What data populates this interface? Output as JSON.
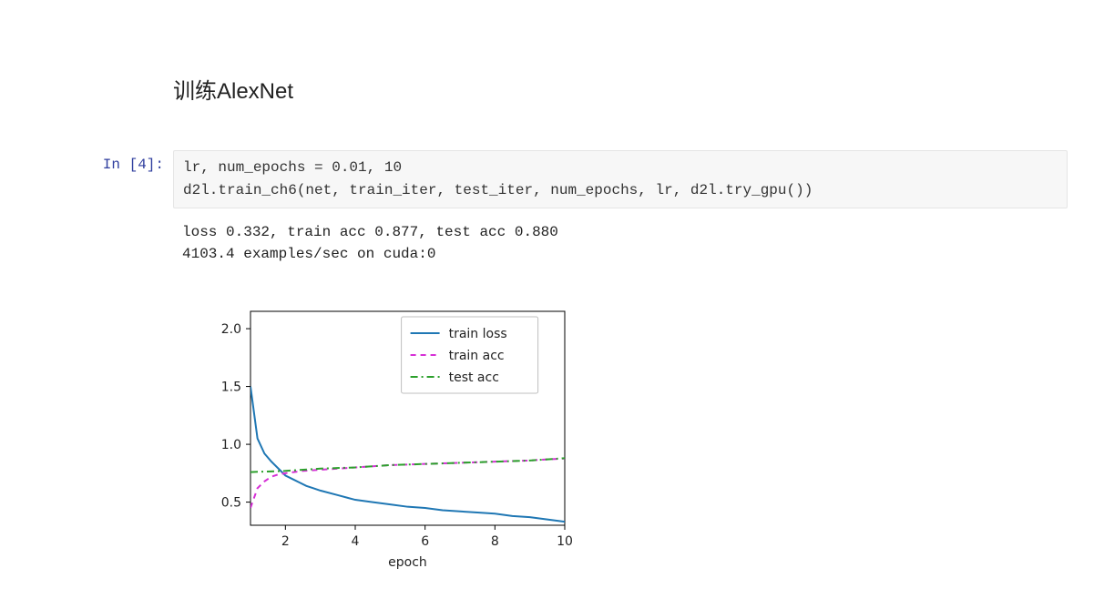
{
  "title": "训练AlexNet",
  "prompt": "In [4]:",
  "code": "lr, num_epochs = 0.01, 10\nd2l.train_ch6(net, train_iter, test_iter, num_epochs, lr, d2l.try_gpu())",
  "output": "loss 0.332, train acc 0.877, test acc 0.880\n4103.4 examples/sec on cuda:0",
  "chart_data": {
    "type": "line",
    "xlabel": "epoch",
    "ylabel": "",
    "xlim": [
      1,
      10
    ],
    "ylim": [
      0.3,
      2.15
    ],
    "x_ticks": [
      2,
      4,
      6,
      8,
      10
    ],
    "y_ticks": [
      0.5,
      1.0,
      1.5,
      2.0
    ],
    "legend": [
      "train loss",
      "train acc",
      "test acc"
    ],
    "series": [
      {
        "name": "train loss",
        "color": "#1f77b4",
        "dash": "solid",
        "x": [
          1.0,
          1.2,
          1.4,
          1.6,
          1.8,
          2.0,
          2.2,
          2.4,
          2.6,
          2.8,
          3.0,
          3.5,
          4.0,
          4.5,
          5.0,
          5.5,
          6.0,
          6.5,
          7.0,
          7.5,
          8.0,
          8.5,
          9.0,
          9.5,
          10.0
        ],
        "values": [
          1.5,
          1.05,
          0.92,
          0.85,
          0.79,
          0.73,
          0.7,
          0.67,
          0.64,
          0.62,
          0.6,
          0.56,
          0.52,
          0.5,
          0.48,
          0.46,
          0.45,
          0.43,
          0.42,
          0.41,
          0.4,
          0.38,
          0.37,
          0.35,
          0.33
        ]
      },
      {
        "name": "train acc",
        "color": "#d62fd6",
        "dash": "dashed",
        "x": [
          1.0,
          1.2,
          1.4,
          1.6,
          1.8,
          2.0,
          2.5,
          3.0,
          3.5,
          4.0,
          4.5,
          5.0,
          5.5,
          6.0,
          6.5,
          7.0,
          7.5,
          8.0,
          8.5,
          9.0,
          9.5,
          10.0
        ],
        "values": [
          0.45,
          0.62,
          0.68,
          0.72,
          0.74,
          0.75,
          0.77,
          0.78,
          0.79,
          0.8,
          0.81,
          0.82,
          0.825,
          0.83,
          0.835,
          0.84,
          0.845,
          0.85,
          0.855,
          0.86,
          0.87,
          0.877
        ]
      },
      {
        "name": "test acc",
        "color": "#2ca02c",
        "dash": "dashdot",
        "x": [
          1.0,
          2.0,
          3.0,
          4.0,
          5.0,
          6.0,
          7.0,
          8.0,
          9.0,
          10.0
        ],
        "values": [
          0.76,
          0.77,
          0.79,
          0.8,
          0.82,
          0.83,
          0.84,
          0.85,
          0.86,
          0.88
        ]
      }
    ]
  }
}
